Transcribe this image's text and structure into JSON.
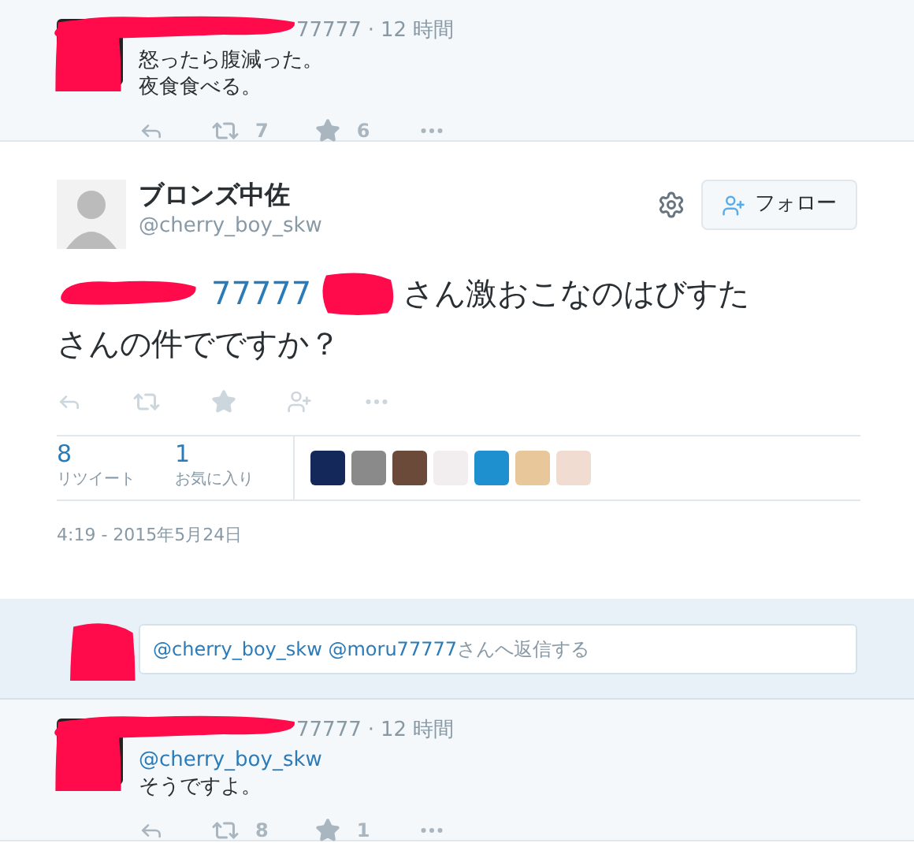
{
  "tweets": [
    {
      "handle_tail": "77777",
      "separator": "·",
      "time": "12 時間",
      "lines": [
        "怒ったら腹減った。",
        "夜食食べる。"
      ],
      "retweets": "7",
      "favorites": "6"
    }
  ],
  "main_tweet": {
    "name": "ブロンズ中佐",
    "handle": "@cherry_boy_skw",
    "follow_label": "フォロー",
    "mention_tail": "77777",
    "text_lines": [
      "さん激おこなのはびすた",
      "さんの件でですか？"
    ],
    "stats": [
      {
        "count": "8",
        "label": "リツイート"
      },
      {
        "count": "1",
        "label": "お気に入り"
      }
    ],
    "favoriters": [
      {
        "color": "#14285a"
      },
      {
        "color": "#8a8a8a"
      },
      {
        "color": "#6b4a3a"
      },
      {
        "color": "#f2eef0"
      },
      {
        "color": "#1e90d0"
      },
      {
        "color": "#e8c89a"
      },
      {
        "color": "#f0dcd0"
      }
    ],
    "timestamp": "4:19 - 2015年5月24日"
  },
  "reply_box": {
    "mentions": "@cherry_boy_skw @moru77777",
    "suffix": "さんへ返信する"
  },
  "replies": [
    {
      "handle_tail": "77777",
      "separator": "·",
      "time": "12 時間",
      "mention": "@cherry_boy_skw",
      "lines": [
        "そうですよ。"
      ],
      "retweets": "8",
      "favorites": "1"
    }
  ]
}
